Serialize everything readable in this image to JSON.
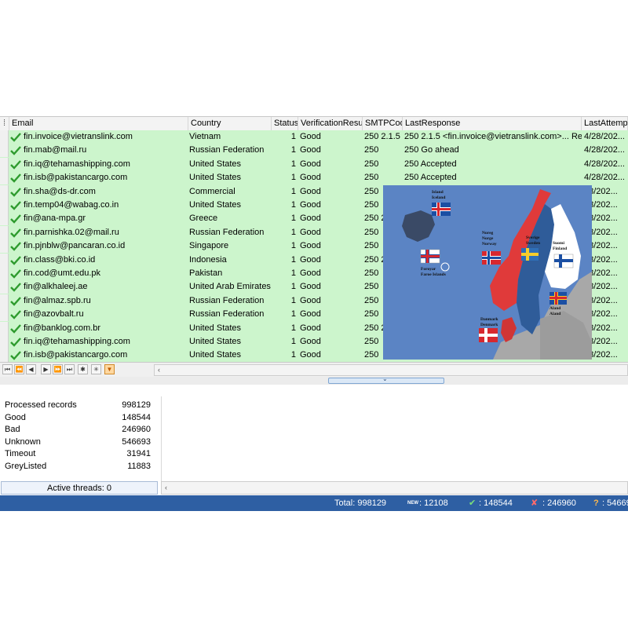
{
  "grid": {
    "columns": [
      {
        "key": "email",
        "label": "Email"
      },
      {
        "key": "country",
        "label": "Country"
      },
      {
        "key": "status",
        "label": "Status"
      },
      {
        "key": "verification",
        "label": "VerificationResult"
      },
      {
        "key": "smtp",
        "label": "SMTPCode"
      },
      {
        "key": "last",
        "label": "LastResponse"
      },
      {
        "key": "attempt",
        "label": "LastAttempt"
      }
    ],
    "rows": [
      {
        "email": "fin.invoice@vietranslink.com",
        "country": "Vietnam",
        "status": "1",
        "verification": "Good",
        "smtp": "250 2.1.5",
        "last": "250 2.1.5 <fin.invoice@vietranslink.com>... Re...",
        "attempt": "4/28/202..."
      },
      {
        "email": "fin.mab@mail.ru",
        "country": "Russian Federation",
        "status": "1",
        "verification": "Good",
        "smtp": "250",
        "last": "250 Go ahead",
        "attempt": "4/28/202..."
      },
      {
        "email": "fin.iq@tehamashipping.com",
        "country": "United States",
        "status": "1",
        "verification": "Good",
        "smtp": "250",
        "last": "250 Accepted",
        "attempt": "4/28/202..."
      },
      {
        "email": "fin.isb@pakistancargo.com",
        "country": "United States",
        "status": "1",
        "verification": "Good",
        "smtp": "250",
        "last": "250 Accepted",
        "attempt": "4/28/202..."
      },
      {
        "email": "fin.sha@ds-dr.com",
        "country": "Commercial",
        "status": "1",
        "verification": "Good",
        "smtp": "250",
        "last": "",
        "attempt": "28/202..."
      },
      {
        "email": "fin.temp04@wabag.co.in",
        "country": "United States",
        "status": "1",
        "verification": "Good",
        "smtp": "250",
        "last": "",
        "attempt": "28/202..."
      },
      {
        "email": "fin@ana-mpa.gr",
        "country": "Greece",
        "status": "1",
        "verification": "Good",
        "smtp": "250 2",
        "last": "",
        "attempt": "28/202..."
      },
      {
        "email": "fin.parnishka.02@mail.ru",
        "country": "Russian Federation",
        "status": "1",
        "verification": "Good",
        "smtp": "250",
        "last": "",
        "attempt": "28/202..."
      },
      {
        "email": "fin.pjnblw@pancaran.co.id",
        "country": "Singapore",
        "status": "1",
        "verification": "Good",
        "smtp": "250",
        "last": "",
        "attempt": "28/202..."
      },
      {
        "email": "fin.class@bki.co.id",
        "country": "Indonesia",
        "status": "1",
        "verification": "Good",
        "smtp": "250 2",
        "last": "",
        "attempt": "28/202..."
      },
      {
        "email": "fin.cod@umt.edu.pk",
        "country": "Pakistan",
        "status": "1",
        "verification": "Good",
        "smtp": "250",
        "last": "",
        "attempt": "28/202..."
      },
      {
        "email": "fin@alkhaleej.ae",
        "country": "United Arab Emirates",
        "status": "1",
        "verification": "Good",
        "smtp": "250",
        "last": "",
        "attempt": "28/202..."
      },
      {
        "email": "fin@almaz.spb.ru",
        "country": "Russian Federation",
        "status": "1",
        "verification": "Good",
        "smtp": "250",
        "last": "",
        "attempt": "28/202..."
      },
      {
        "email": "fin@azovbalt.ru",
        "country": "Russian Federation",
        "status": "1",
        "verification": "Good",
        "smtp": "250",
        "last": "",
        "attempt": "28/202..."
      },
      {
        "email": "fin@banklog.com.br",
        "country": "United States",
        "status": "1",
        "verification": "Good",
        "smtp": "250 2",
        "last": "",
        "attempt": "28/202..."
      },
      {
        "email": "fin.iq@tehamashipping.com",
        "country": "United States",
        "status": "1",
        "verification": "Good",
        "smtp": "250",
        "last": "",
        "attempt": "28/202..."
      },
      {
        "email": "fin.isb@pakistancargo.com",
        "country": "United States",
        "status": "1",
        "verification": "Good",
        "smtp": "250",
        "last": "",
        "attempt": "28/202..."
      }
    ],
    "row_color": "#ccf5cc"
  },
  "map": {
    "labels": {
      "iceland": [
        "Island",
        "Iceland"
      ],
      "norway": [
        "Noreg",
        "Norge",
        "Norway"
      ],
      "sweden": [
        "Sverige",
        "Sweden"
      ],
      "finland": [
        "Suomi",
        "Finland"
      ],
      "faroe": [
        "Foroyar",
        "Faroe Islands"
      ],
      "denmark": [
        "Danmark",
        "Denmark"
      ],
      "aland": [
        "Aland",
        "Aland"
      ]
    }
  },
  "navigator": {
    "buttons": [
      "first",
      "prev-page",
      "prev",
      "next",
      "next-page",
      "last",
      "insert",
      "delete",
      "filter"
    ]
  },
  "stats": [
    {
      "label": "Processed records",
      "value": "998129"
    },
    {
      "label": "Good",
      "value": "148544"
    },
    {
      "label": "Bad",
      "value": "246960"
    },
    {
      "label": "Unknown",
      "value": "546693"
    },
    {
      "label": "Timeout",
      "value": "31941"
    },
    {
      "label": "GreyListed",
      "value": "11883"
    }
  ],
  "threads_label": "Active threads: 0",
  "statusbar": {
    "total": "Total: 998129",
    "new_badge": "NEW",
    "new_value": ": 12108",
    "good_value": ": 148544",
    "bad_value": ": 246960",
    "unknown_value": ": 54669"
  },
  "colors": {
    "statusbar": "#2e5fa3",
    "row_good": "#ccf5cc",
    "check": "#2e9b2e"
  }
}
